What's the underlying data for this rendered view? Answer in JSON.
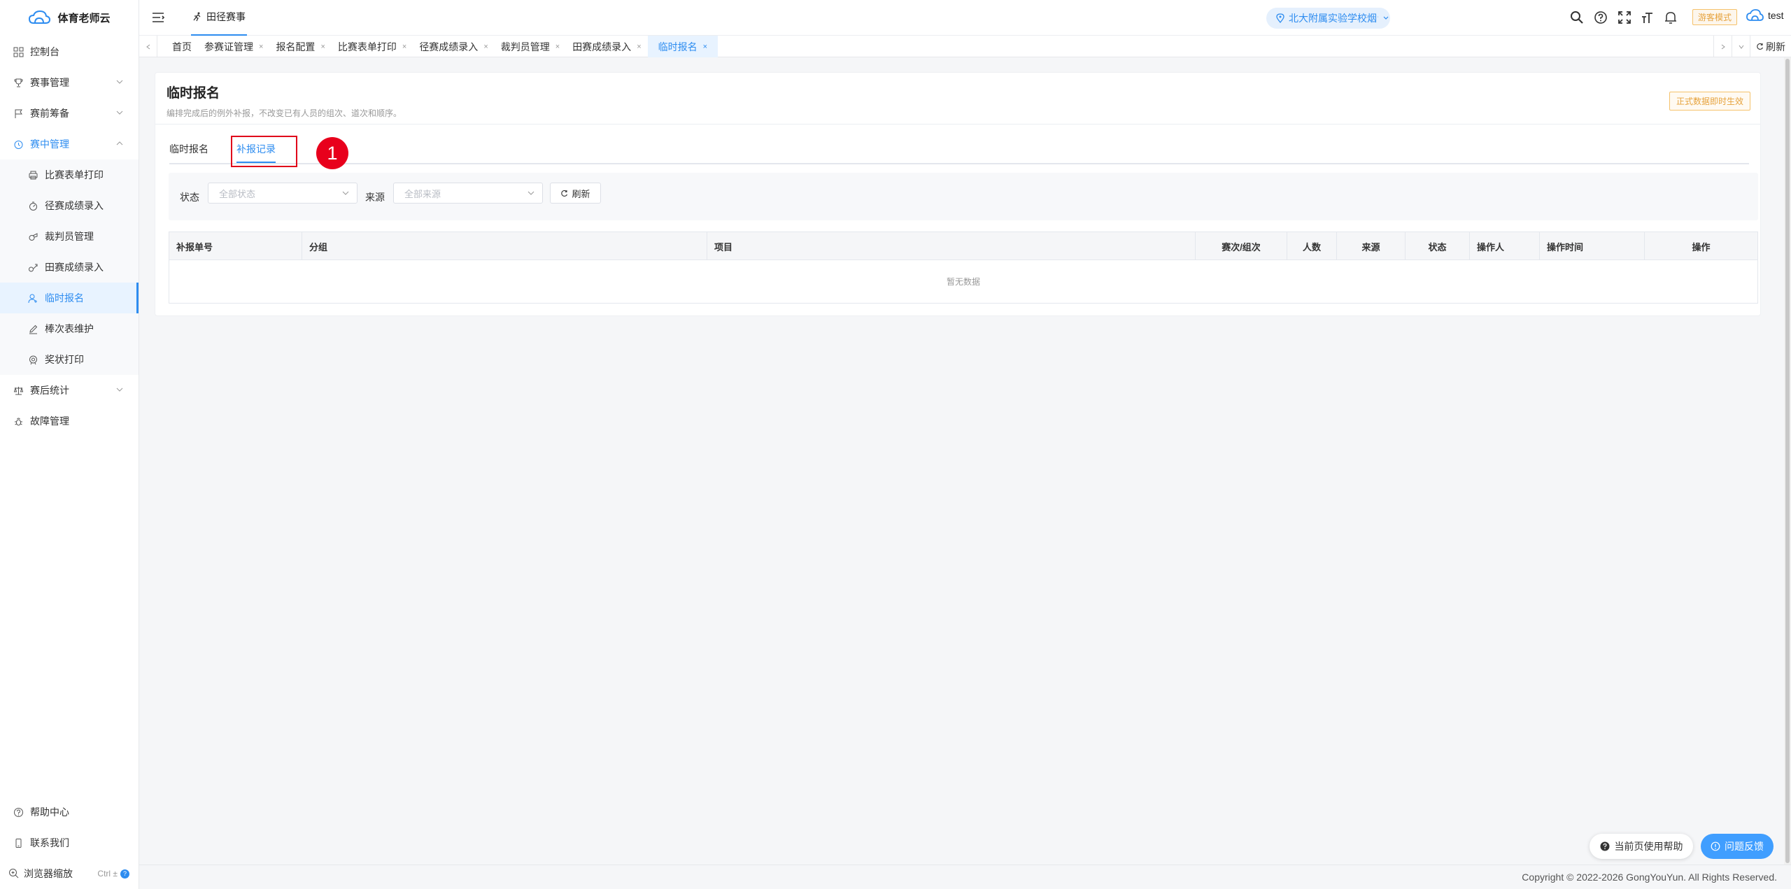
{
  "app": {
    "name": "体育老师云"
  },
  "sidebar": {
    "items": [
      {
        "label": "控制台",
        "icon": "dashboard-icon"
      },
      {
        "label": "赛事管理",
        "icon": "trophy-icon"
      },
      {
        "label": "赛前筹备",
        "icon": "flag-icon"
      },
      {
        "label": "赛中管理",
        "icon": "clock-icon"
      }
    ],
    "sub_items": [
      {
        "label": "比赛表单打印"
      },
      {
        "label": "径赛成绩录入"
      },
      {
        "label": "裁判员管理"
      },
      {
        "label": "田赛成绩录入"
      },
      {
        "label": "临时报名"
      },
      {
        "label": "棒次表维护"
      },
      {
        "label": "奖状打印"
      }
    ],
    "after_items": [
      {
        "label": "赛后统计"
      },
      {
        "label": "故障管理"
      }
    ],
    "bottom": {
      "help": "帮助中心",
      "contact": "联系我们",
      "zoom": "浏览器缩放",
      "zoom_key": "Ctrl ±"
    }
  },
  "topbar": {
    "tab": "田径赛事",
    "school": "北大附属实验学校烟台...",
    "guest_mode": "游客模式",
    "user": "test"
  },
  "tabs": {
    "items": [
      {
        "label": "首页",
        "closable": false
      },
      {
        "label": "参赛证管理",
        "closable": true
      },
      {
        "label": "报名配置",
        "closable": true
      },
      {
        "label": "比赛表单打印",
        "closable": true
      },
      {
        "label": "径赛成绩录入",
        "closable": true
      },
      {
        "label": "裁判员管理",
        "closable": true
      },
      {
        "label": "田赛成绩录入",
        "closable": true
      },
      {
        "label": "临时报名",
        "closable": true,
        "active": true
      }
    ],
    "close_glyph": "×",
    "refresh": "刷新"
  },
  "page": {
    "title": "临时报名",
    "subtitle": "编排完成后的例外补报，不改变已有人员的组次、道次和顺序。",
    "status_tag": "正式数据即时生效",
    "tab_temp": "临时报名",
    "tab_records": "补报记录",
    "badge": "1"
  },
  "filter": {
    "status_label": "状态",
    "status_placeholder": "全部状态",
    "source_label": "来源",
    "source_placeholder": "全部来源",
    "refresh": "刷新"
  },
  "table": {
    "columns": [
      "补报单号",
      "分组",
      "项目",
      "赛次/组次",
      "人数",
      "来源",
      "状态",
      "操作人",
      "操作时间",
      "操作"
    ],
    "empty": "暂无数据"
  },
  "footer": {
    "copyright": "Copyright © 2022-2026 GongYouYun. All Rights Reserved.",
    "help_btn": "当前页使用帮助",
    "feedback_btn": "问题反馈"
  }
}
